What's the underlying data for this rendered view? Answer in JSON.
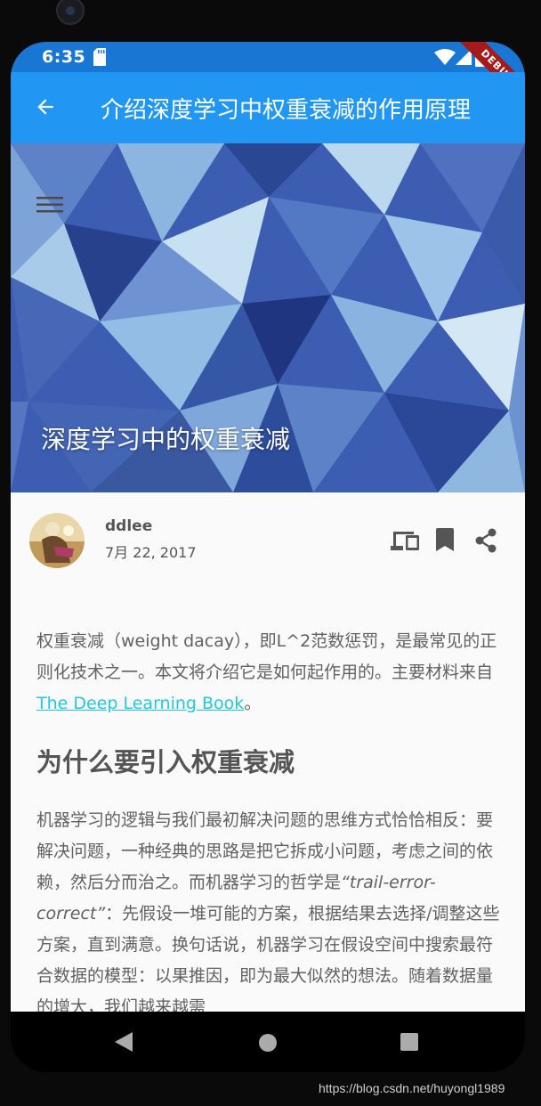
{
  "status_bar": {
    "time": "6:35",
    "debug_label": "DEBUG"
  },
  "app_bar": {
    "title": "介绍深度学习中权重衰减的作用原理",
    "back_icon": "arrow-back-icon",
    "color": "#2196f3"
  },
  "hero": {
    "title": "深度学习中的权重衰减",
    "menu_icon": "menu-icon"
  },
  "author": {
    "name": "ddlee",
    "date": "7月 22, 2017"
  },
  "actions": [
    "devices-icon",
    "bookmark-icon",
    "share-icon"
  ],
  "article": {
    "intro_text": "权重衰减（weight dacay），即L^2范数惩罚，是最常见的正则化技术之一。本文将介绍它是如何起作用的。主要材料来自",
    "intro_link": "The Deep Learning Book",
    "intro_end": "。",
    "heading": "为什么要引入权重衰减",
    "p2_text_a": "机器学习的逻辑与我们最初解决问题的思维方式恰恰相反：要解决问题，一种经典的思路是把它拆成小问题，考虑之间的依赖，然后分而治之。而机器学习的哲学是",
    "p2_italic": "“trail-error-correct”",
    "p2_text_b": "：先假设一堆可能的方案，根据结果去选择/调整这些方案，直到满意。换句话说，机器学习在假设空间中搜索最符合数据的模型：以果推因，即为最大似然的想法。随着数据量的增大，我们越来越需"
  },
  "nav_bar": [
    "back-triangle-icon",
    "home-circle-icon",
    "recents-square-icon"
  ],
  "watermark": "https://blog.csdn.net/huyongl1989",
  "colors": {
    "status_bar": "#1976d2",
    "link": "#26c6da",
    "body_text": "#616161"
  }
}
